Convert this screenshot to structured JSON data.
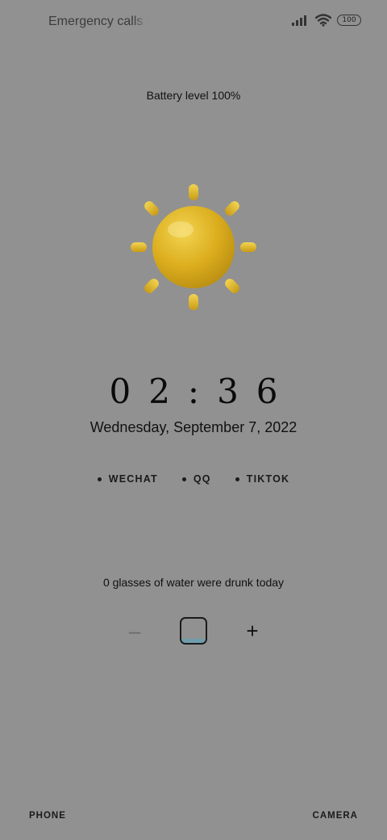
{
  "status_bar": {
    "carrier_text": "Emergency calls only",
    "battery_percent": "100",
    "icons": [
      "signal-icon",
      "wifi-icon",
      "battery-icon"
    ]
  },
  "lockscreen": {
    "battery_level_text": "Battery level 100%",
    "weather_icon": "sun-icon",
    "time": "02:36",
    "date": "Wednesday, September 7, 2022",
    "apps": [
      {
        "label": "WECHAT"
      },
      {
        "label": "QQ"
      },
      {
        "label": "TIKTOK"
      }
    ],
    "water": {
      "text": "0 glasses of water were drunk today",
      "minus_label": "–",
      "plus_label": "+",
      "glass_icon": "glass-icon"
    },
    "shortcuts": {
      "left": "PHONE",
      "right": "CAMERA"
    }
  },
  "colors": {
    "background": "#919191",
    "sun": "#e8b51f",
    "water": "#6f9dab"
  }
}
